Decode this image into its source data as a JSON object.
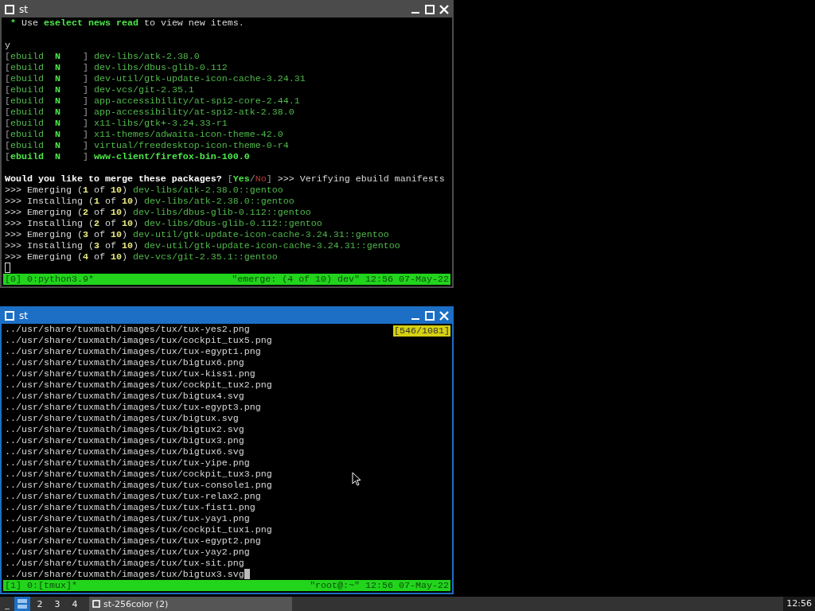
{
  "windows": [
    {
      "title": "st",
      "active": false,
      "lines": [
        {
          "kind": "text",
          "segments": [
            {
              "kind": "green-bold",
              "text": " * "
            },
            {
              "kind": "plain",
              "text": "Use "
            },
            {
              "kind": "green-bold",
              "text": "eselect news read"
            },
            {
              "kind": "plain",
              "text": " to view new items."
            }
          ]
        },
        {
          "kind": "blank"
        },
        {
          "kind": "text",
          "segments": [
            {
              "kind": "plain",
              "text": "y"
            }
          ]
        },
        {
          "kind": "text",
          "segments": [
            {
              "kind": "dim",
              "text": "["
            },
            {
              "kind": "green",
              "text": "ebuild  "
            },
            {
              "kind": "green-bold",
              "text": "N"
            },
            {
              "kind": "dim",
              "text": "    ] "
            },
            {
              "kind": "green",
              "text": "dev-libs/atk-2.38.0"
            }
          ]
        },
        {
          "kind": "text",
          "segments": [
            {
              "kind": "dim",
              "text": "["
            },
            {
              "kind": "green",
              "text": "ebuild  "
            },
            {
              "kind": "green-bold",
              "text": "N"
            },
            {
              "kind": "dim",
              "text": "    ] "
            },
            {
              "kind": "green",
              "text": "dev-libs/dbus-glib-0.112"
            }
          ]
        },
        {
          "kind": "text",
          "segments": [
            {
              "kind": "dim",
              "text": "["
            },
            {
              "kind": "green",
              "text": "ebuild  "
            },
            {
              "kind": "green-bold",
              "text": "N"
            },
            {
              "kind": "dim",
              "text": "    ] "
            },
            {
              "kind": "green",
              "text": "dev-util/gtk-update-icon-cache-3.24.31"
            }
          ]
        },
        {
          "kind": "text",
          "segments": [
            {
              "kind": "dim",
              "text": "["
            },
            {
              "kind": "green",
              "text": "ebuild  "
            },
            {
              "kind": "green-bold",
              "text": "N"
            },
            {
              "kind": "dim",
              "text": "    ] "
            },
            {
              "kind": "green",
              "text": "dev-vcs/git-2.35.1"
            }
          ]
        },
        {
          "kind": "text",
          "segments": [
            {
              "kind": "dim",
              "text": "["
            },
            {
              "kind": "green",
              "text": "ebuild  "
            },
            {
              "kind": "green-bold",
              "text": "N"
            },
            {
              "kind": "dim",
              "text": "    ] "
            },
            {
              "kind": "green",
              "text": "app-accessibility/at-spi2-core-2.44.1"
            }
          ]
        },
        {
          "kind": "text",
          "segments": [
            {
              "kind": "dim",
              "text": "["
            },
            {
              "kind": "green",
              "text": "ebuild  "
            },
            {
              "kind": "green-bold",
              "text": "N"
            },
            {
              "kind": "dim",
              "text": "    ] "
            },
            {
              "kind": "green",
              "text": "app-accessibility/at-spi2-atk-2.38.0"
            }
          ]
        },
        {
          "kind": "text",
          "segments": [
            {
              "kind": "dim",
              "text": "["
            },
            {
              "kind": "green",
              "text": "ebuild  "
            },
            {
              "kind": "green-bold",
              "text": "N"
            },
            {
              "kind": "dim",
              "text": "    ] "
            },
            {
              "kind": "green",
              "text": "x11-libs/gtk+-3.24.33-r1"
            }
          ]
        },
        {
          "kind": "text",
          "segments": [
            {
              "kind": "dim",
              "text": "["
            },
            {
              "kind": "green",
              "text": "ebuild  "
            },
            {
              "kind": "green-bold",
              "text": "N"
            },
            {
              "kind": "dim",
              "text": "    ] "
            },
            {
              "kind": "green",
              "text": "x11-themes/adwaita-icon-theme-42.0"
            }
          ]
        },
        {
          "kind": "text",
          "segments": [
            {
              "kind": "dim",
              "text": "["
            },
            {
              "kind": "green",
              "text": "ebuild  "
            },
            {
              "kind": "green-bold",
              "text": "N"
            },
            {
              "kind": "dim",
              "text": "    ] "
            },
            {
              "kind": "green",
              "text": "virtual/freedesktop-icon-theme-0-r4"
            }
          ]
        },
        {
          "kind": "text",
          "segments": [
            {
              "kind": "dim",
              "text": "["
            },
            {
              "kind": "green-bold",
              "text": "ebuild  N"
            },
            {
              "kind": "dim",
              "text": "    ] "
            },
            {
              "kind": "green-bold",
              "text": "www-client/firefox-bin-100.0"
            }
          ]
        },
        {
          "kind": "blank"
        },
        {
          "kind": "text",
          "segments": [
            {
              "kind": "bold",
              "text": "Would you like to merge these packages? "
            },
            {
              "kind": "dim",
              "text": "["
            },
            {
              "kind": "green-bold",
              "text": "Yes"
            },
            {
              "kind": "dim",
              "text": "/"
            },
            {
              "kind": "red",
              "text": "No"
            },
            {
              "kind": "dim",
              "text": "]"
            },
            {
              "kind": "plain",
              "text": " >>> Verifying ebuild manifests"
            }
          ]
        },
        {
          "kind": "text",
          "segments": [
            {
              "kind": "plain",
              "text": ">>> Emerging ("
            },
            {
              "kind": "yellow",
              "text": "1"
            },
            {
              "kind": "plain",
              "text": " of "
            },
            {
              "kind": "yellow",
              "text": "10"
            },
            {
              "kind": "plain",
              "text": ") "
            },
            {
              "kind": "green",
              "text": "dev-libs/atk-2.38.0::gentoo"
            }
          ]
        },
        {
          "kind": "text",
          "segments": [
            {
              "kind": "plain",
              "text": ">>> Installing ("
            },
            {
              "kind": "yellow",
              "text": "1"
            },
            {
              "kind": "plain",
              "text": " of "
            },
            {
              "kind": "yellow",
              "text": "10"
            },
            {
              "kind": "plain",
              "text": ") "
            },
            {
              "kind": "green",
              "text": "dev-libs/atk-2.38.0::gentoo"
            }
          ]
        },
        {
          "kind": "text",
          "segments": [
            {
              "kind": "plain",
              "text": ">>> Emerging ("
            },
            {
              "kind": "yellow",
              "text": "2"
            },
            {
              "kind": "plain",
              "text": " of "
            },
            {
              "kind": "yellow",
              "text": "10"
            },
            {
              "kind": "plain",
              "text": ") "
            },
            {
              "kind": "green",
              "text": "dev-libs/dbus-glib-0.112::gentoo"
            }
          ]
        },
        {
          "kind": "text",
          "segments": [
            {
              "kind": "plain",
              "text": ">>> Installing ("
            },
            {
              "kind": "yellow",
              "text": "2"
            },
            {
              "kind": "plain",
              "text": " of "
            },
            {
              "kind": "yellow",
              "text": "10"
            },
            {
              "kind": "plain",
              "text": ") "
            },
            {
              "kind": "green",
              "text": "dev-libs/dbus-glib-0.112::gentoo"
            }
          ]
        },
        {
          "kind": "text",
          "segments": [
            {
              "kind": "plain",
              "text": ">>> Emerging ("
            },
            {
              "kind": "yellow",
              "text": "3"
            },
            {
              "kind": "plain",
              "text": " of "
            },
            {
              "kind": "yellow",
              "text": "10"
            },
            {
              "kind": "plain",
              "text": ") "
            },
            {
              "kind": "green",
              "text": "dev-util/gtk-update-icon-cache-3.24.31::gentoo"
            }
          ]
        },
        {
          "kind": "text",
          "segments": [
            {
              "kind": "plain",
              "text": ">>> Installing ("
            },
            {
              "kind": "yellow",
              "text": "3"
            },
            {
              "kind": "plain",
              "text": " of "
            },
            {
              "kind": "yellow",
              "text": "10"
            },
            {
              "kind": "plain",
              "text": ") "
            },
            {
              "kind": "green",
              "text": "dev-util/gtk-update-icon-cache-3.24.31::gentoo"
            }
          ]
        },
        {
          "kind": "text",
          "segments": [
            {
              "kind": "plain",
              "text": ">>> Emerging ("
            },
            {
              "kind": "yellow",
              "text": "4"
            },
            {
              "kind": "plain",
              "text": " of "
            },
            {
              "kind": "yellow",
              "text": "10"
            },
            {
              "kind": "plain",
              "text": ") "
            },
            {
              "kind": "green",
              "text": "dev-vcs/git-2.35.1::gentoo"
            }
          ]
        },
        {
          "kind": "cursor"
        }
      ],
      "status": {
        "left": "[0] 0:python3.9*",
        "right": "\"emerge: (4 of 10) dev\" 12:56 07-May-22"
      }
    },
    {
      "title": "st",
      "active": true,
      "badge": "[546/1081]",
      "lines": [
        {
          "kind": "text",
          "text": "../usr/share/tuxmath/images/tux/tux-yes2.png"
        },
        {
          "kind": "text",
          "text": "../usr/share/tuxmath/images/tux/cockpit_tux5.png"
        },
        {
          "kind": "text",
          "text": "../usr/share/tuxmath/images/tux/tux-egypt1.png"
        },
        {
          "kind": "text",
          "text": "../usr/share/tuxmath/images/tux/bigtux6.png"
        },
        {
          "kind": "text",
          "text": "../usr/share/tuxmath/images/tux/tux-kiss1.png"
        },
        {
          "kind": "text",
          "text": "../usr/share/tuxmath/images/tux/cockpit_tux2.png"
        },
        {
          "kind": "text",
          "text": "../usr/share/tuxmath/images/tux/bigtux4.svg"
        },
        {
          "kind": "text",
          "text": "../usr/share/tuxmath/images/tux/tux-egypt3.png"
        },
        {
          "kind": "text",
          "text": "../usr/share/tuxmath/images/tux/bigtux.svg"
        },
        {
          "kind": "text",
          "text": "../usr/share/tuxmath/images/tux/bigtux2.svg"
        },
        {
          "kind": "text",
          "text": "../usr/share/tuxmath/images/tux/bigtux3.png"
        },
        {
          "kind": "text",
          "text": "../usr/share/tuxmath/images/tux/bigtux6.svg"
        },
        {
          "kind": "text",
          "text": "../usr/share/tuxmath/images/tux/tux-yipe.png"
        },
        {
          "kind": "text",
          "text": "../usr/share/tuxmath/images/tux/cockpit_tux3.png"
        },
        {
          "kind": "text",
          "text": "../usr/share/tuxmath/images/tux/tux-console1.png"
        },
        {
          "kind": "text",
          "text": "../usr/share/tuxmath/images/tux/tux-relax2.png"
        },
        {
          "kind": "text",
          "text": "../usr/share/tuxmath/images/tux/tux-fist1.png"
        },
        {
          "kind": "text",
          "text": "../usr/share/tuxmath/images/tux/tux-yay1.png"
        },
        {
          "kind": "text",
          "text": "../usr/share/tuxmath/images/tux/cockpit_tux1.png"
        },
        {
          "kind": "text",
          "text": "../usr/share/tuxmath/images/tux/tux-egypt2.png"
        },
        {
          "kind": "text",
          "text": "../usr/share/tuxmath/images/tux/tux-yay2.png"
        },
        {
          "kind": "text",
          "text": "../usr/share/tuxmath/images/tux/tux-sit.png"
        },
        {
          "kind": "cursor",
          "text": "../usr/share/tuxmath/images/tux/bigtux3.svg"
        }
      ],
      "status": {
        "left": "[1] 0:[tmux]*",
        "right": "\"root@:~\" 12:56 07-May-22"
      }
    }
  ],
  "taskbar": {
    "symbol": "_",
    "tags": [
      {
        "kind": "icon",
        "selected": true
      },
      {
        "kind": "number",
        "label": "2",
        "selected": false
      },
      {
        "kind": "number",
        "label": "3",
        "selected": false
      },
      {
        "kind": "number",
        "label": "4",
        "selected": false
      }
    ],
    "task": "st-256color (2)",
    "clock": "12:56"
  }
}
